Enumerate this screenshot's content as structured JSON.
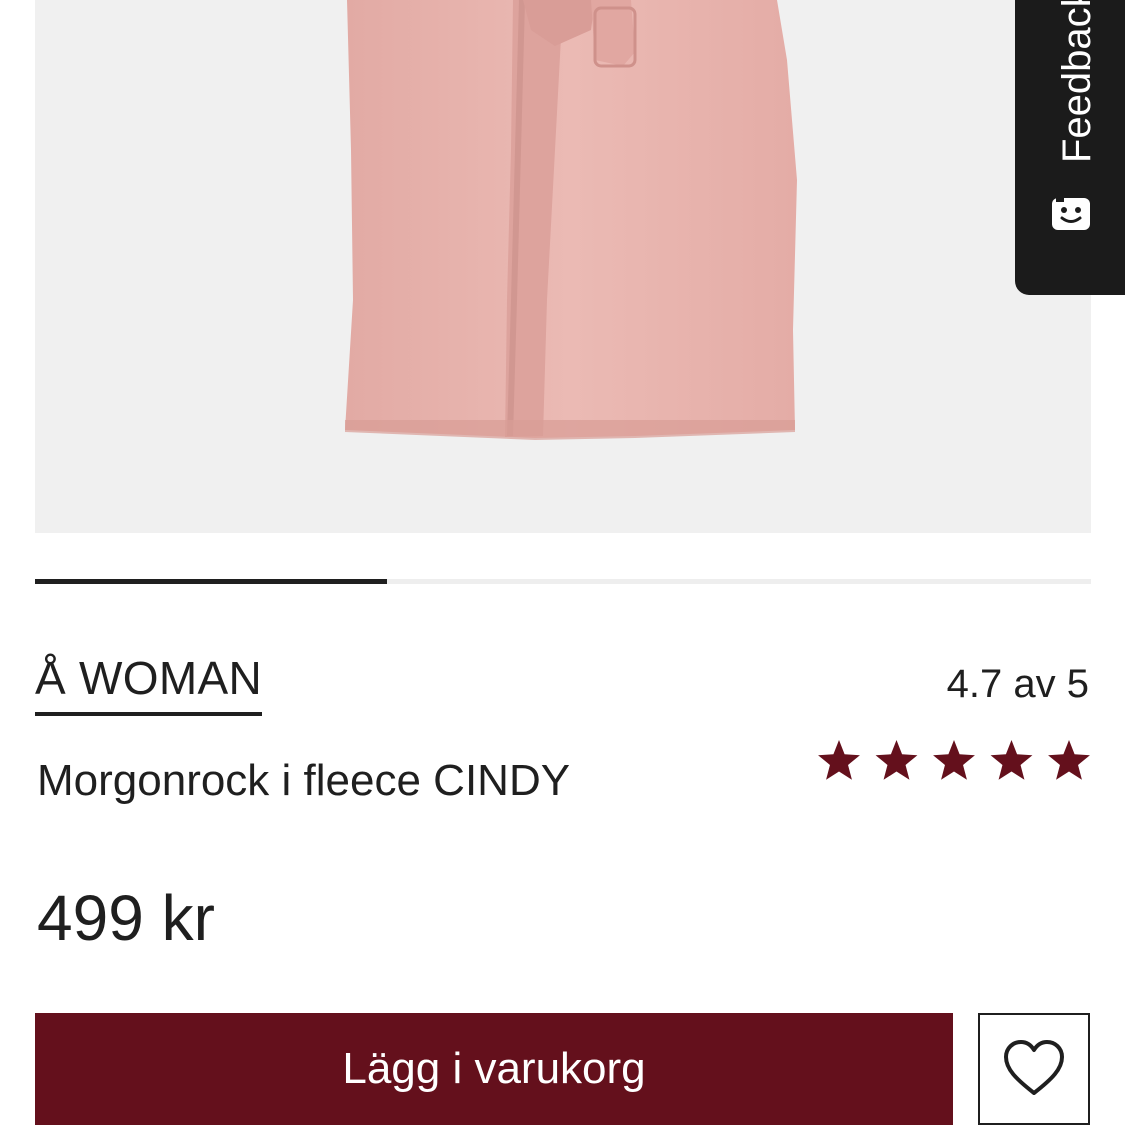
{
  "product": {
    "brand": "Å WOMAN",
    "title": "Morgonrock i fleece CINDY",
    "price": "499 kr",
    "rating_text": "4.7 av 5",
    "rating_value": 4.7,
    "rating_max": 5
  },
  "gallery": {
    "image": "pink fleece robe",
    "progress_fraction": 0.333
  },
  "actions": {
    "add_to_cart_label": "Lägg i varukorg",
    "wishlist_icon": "heart-icon"
  },
  "feedback_tab": {
    "label": "Feedback",
    "icon": "smiley-icon"
  },
  "colors": {
    "accent": "#64101c",
    "star": "#64101c",
    "robe": "#e8b5af",
    "feedback_bg": "#1b1b1b"
  }
}
